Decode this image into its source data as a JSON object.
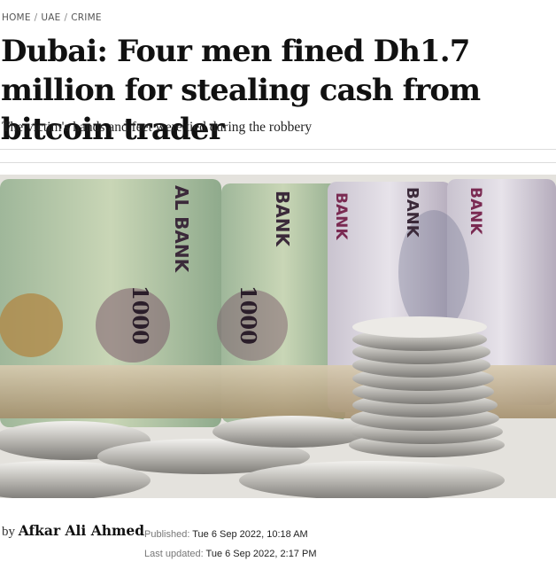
{
  "breadcrumb": {
    "home": "HOME",
    "section": "UAE",
    "subsection": "CRIME",
    "separator": "/"
  },
  "article": {
    "headline": "Dubai: Four men fined Dh1.7 million for stealing cash from bitcoin trader",
    "subheadline": "The victim's hands and feet were tied during the robbery",
    "image": {
      "banknote_text_1": "AL BANK",
      "banknote_text_2": "BANK",
      "banknote_text_3": "BANK",
      "banknote_text_4": "BANK",
      "banknote_text_5": "BANK",
      "denomination_1": "1000",
      "denomination_2": "1000"
    },
    "byline": {
      "prefix": "by",
      "author": "Afkar Ali Ahmed"
    },
    "published": {
      "label": "Published:",
      "value": "Tue 6 Sep 2022, 10:18 AM"
    },
    "updated": {
      "label": "Last updated:",
      "value": "Tue 6 Sep 2022, 2:17 PM"
    }
  },
  "colors": {
    "headline": "#111111",
    "meta_label": "#777777",
    "rule": "#dcdcdc"
  }
}
